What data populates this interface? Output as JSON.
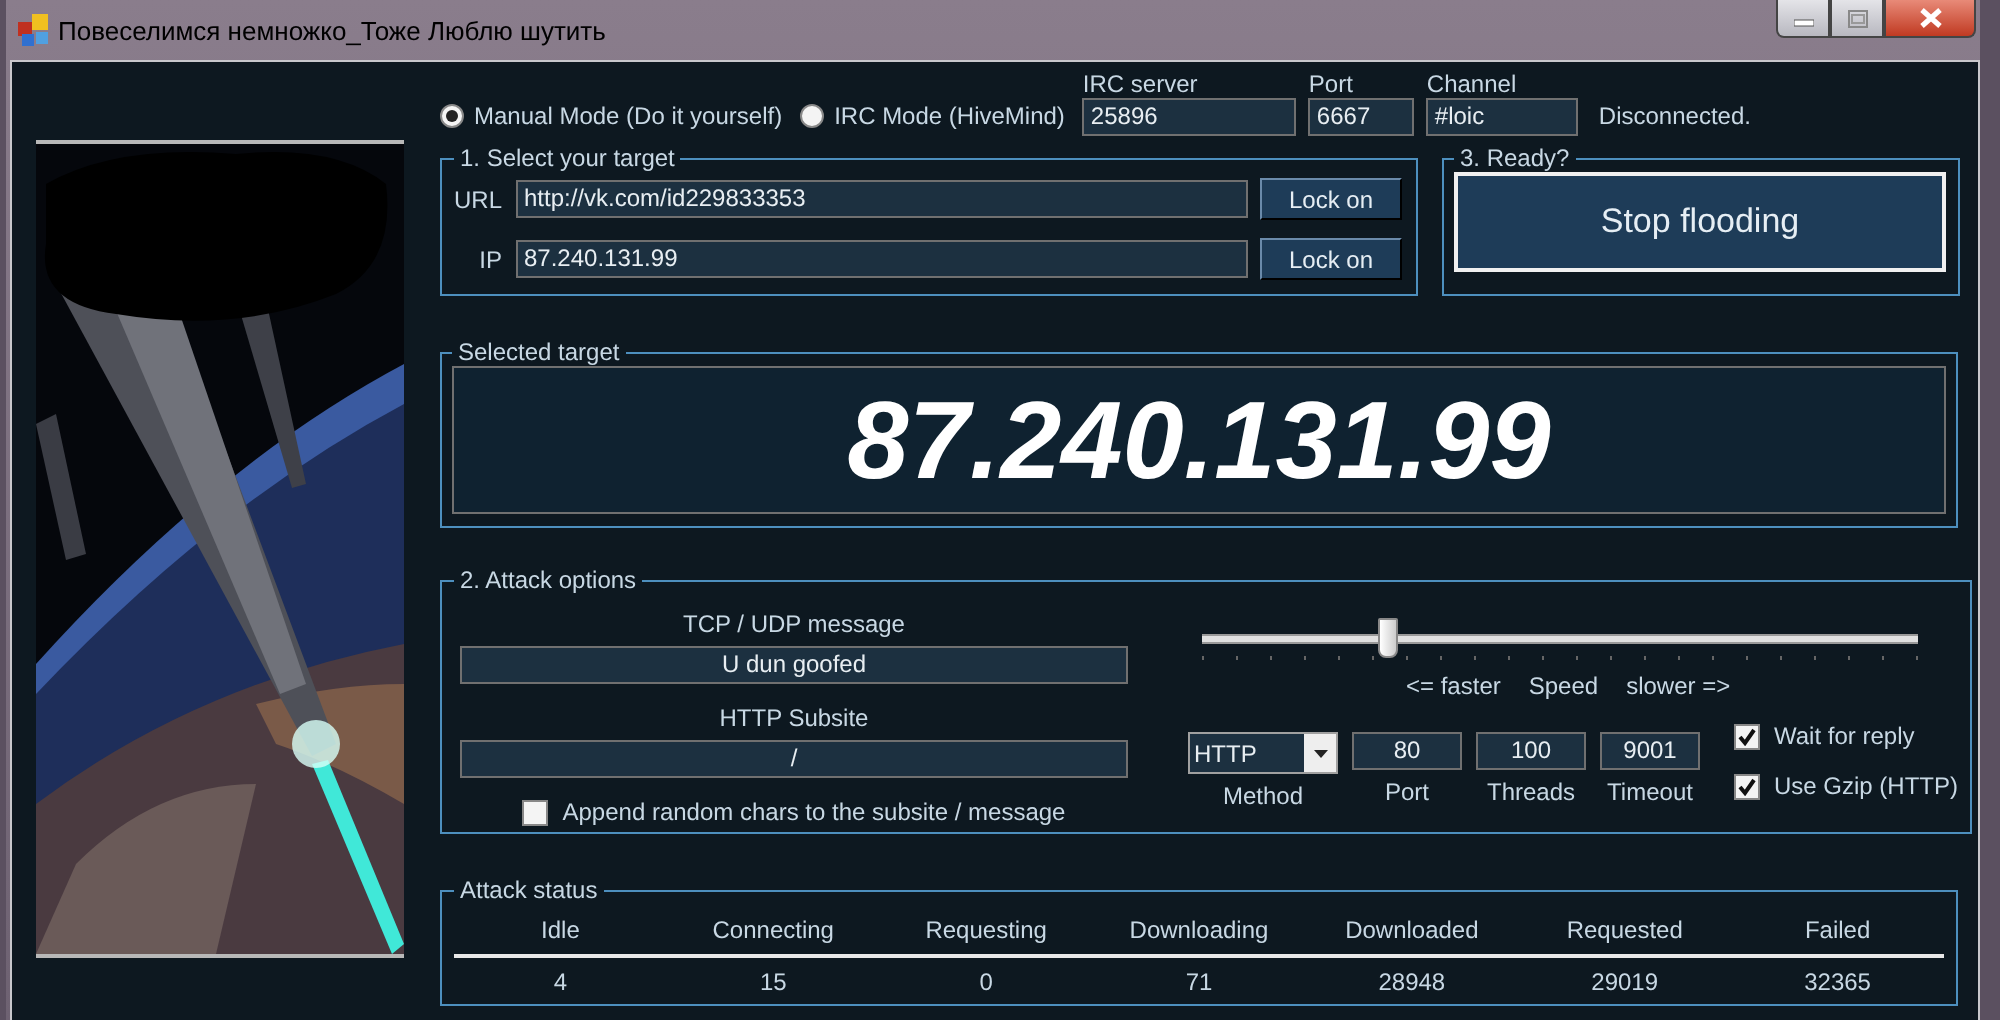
{
  "window": {
    "title": "Повеселимся немножко_Тоже Люблю шутить"
  },
  "mode_options": [
    {
      "label": "Manual Mode (Do it yourself)",
      "selected": true
    },
    {
      "label": "IRC Mode (HiveMind)",
      "selected": false
    }
  ],
  "irc": {
    "fields": [
      {
        "label": "IRC server",
        "value": "25896"
      },
      {
        "label": "Port",
        "value": "6667"
      },
      {
        "label": "Channel",
        "value": "#loic"
      }
    ],
    "status": "Disconnected."
  },
  "select_target": {
    "title": "1. Select your target",
    "rows": [
      {
        "label": "URL",
        "value": "http://vk.com/id229833353",
        "button": "Lock on"
      },
      {
        "label": "IP",
        "value": "87.240.131.99",
        "button": "Lock on"
      }
    ]
  },
  "ready": {
    "title": "3. Ready?",
    "button": "Stop flooding"
  },
  "selected_target": {
    "title": "Selected target",
    "value": "87.240.131.99"
  },
  "attack_options": {
    "title": "2. Attack options",
    "tcp_udp_message": {
      "label": "TCP / UDP message",
      "value": "U dun goofed"
    },
    "http_subsite": {
      "label": "HTTP Subsite",
      "value": "/"
    },
    "append_random": {
      "label": "Append random chars to the subsite / message",
      "checked": false
    },
    "speed": {
      "level": 0.26,
      "labels": [
        "<= faster",
        "Speed",
        "slower =>"
      ]
    },
    "method": {
      "label": "Method",
      "value": "HTTP"
    },
    "numbers": [
      {
        "label": "Port",
        "value": "80"
      },
      {
        "label": "Threads",
        "value": "100"
      },
      {
        "label": "Timeout",
        "value": "9001"
      }
    ],
    "checkboxes": [
      {
        "label": "Wait for reply",
        "checked": true
      },
      {
        "label": "Use Gzip (HTTP)",
        "checked": true
      }
    ]
  },
  "attack_status": {
    "title": "Attack status",
    "columns": [
      "Idle",
      "Connecting",
      "Requesting",
      "Downloading",
      "Downloaded",
      "Requested",
      "Failed"
    ],
    "rows": [
      [
        "4",
        "15",
        "0",
        "71",
        "28948",
        "29019",
        "32365"
      ]
    ]
  }
}
